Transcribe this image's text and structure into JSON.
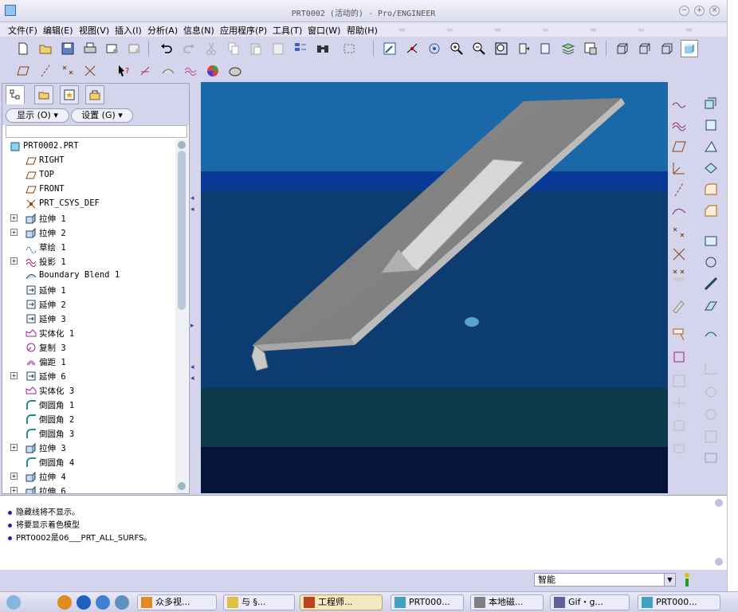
{
  "window": {
    "title": "PRT0002 (活动的) - Pro/ENGINEER"
  },
  "menu": [
    "文件(F)",
    "编辑(E)",
    "视图(V)",
    "插入(I)",
    "分析(A)",
    "信息(N)",
    "应用程序(P)",
    "工具(T)",
    "窗口(W)",
    "帮助(H)"
  ],
  "panel": {
    "show_label": "显示 (O) ▾",
    "settings_label": "设置 (G) ▾"
  },
  "tree": [
    {
      "label": "PRT0002.PRT",
      "icon": "part-icon",
      "expand": false,
      "indent": 0
    },
    {
      "label": "RIGHT",
      "icon": "datum-plane-icon",
      "expand": false,
      "indent": 1
    },
    {
      "label": "TOP",
      "icon": "datum-plane-icon",
      "expand": false,
      "indent": 1
    },
    {
      "label": "FRONT",
      "icon": "datum-plane-icon",
      "expand": false,
      "indent": 1
    },
    {
      "label": "PRT_CSYS_DEF",
      "icon": "csys-icon",
      "expand": false,
      "indent": 1
    },
    {
      "label": "拉伸 1",
      "icon": "extrude-icon",
      "expand": true,
      "indent": 1
    },
    {
      "label": "拉伸 2",
      "icon": "extrude-icon",
      "expand": true,
      "indent": 1
    },
    {
      "label": "草绘 1",
      "icon": "sketch-icon",
      "expand": false,
      "indent": 1
    },
    {
      "label": "投影 1",
      "icon": "projection-icon",
      "expand": true,
      "indent": 1
    },
    {
      "label": "Boundary Blend 1",
      "icon": "boundary-blend-icon",
      "expand": false,
      "indent": 1
    },
    {
      "label": "延伸 1",
      "icon": "extend-icon",
      "expand": false,
      "indent": 1
    },
    {
      "label": "延伸 2",
      "icon": "extend-icon",
      "expand": false,
      "indent": 1
    },
    {
      "label": "延伸 3",
      "icon": "extend-icon",
      "expand": false,
      "indent": 1
    },
    {
      "label": "实体化 1",
      "icon": "solidify-icon",
      "expand": false,
      "indent": 1
    },
    {
      "label": "复制 3",
      "icon": "copy-icon",
      "expand": false,
      "indent": 1
    },
    {
      "label": "偏距 1",
      "icon": "offset-icon",
      "expand": false,
      "indent": 1
    },
    {
      "label": "延伸 6",
      "icon": "extend-icon",
      "expand": true,
      "indent": 1
    },
    {
      "label": "实体化 3",
      "icon": "solidify-icon",
      "expand": false,
      "indent": 1
    },
    {
      "label": "倒圆角 1",
      "icon": "round-icon",
      "expand": false,
      "indent": 1
    },
    {
      "label": "倒圆角 2",
      "icon": "round-icon",
      "expand": false,
      "indent": 1
    },
    {
      "label": "倒圆角 3",
      "icon": "round-icon",
      "expand": false,
      "indent": 1
    },
    {
      "label": "拉伸 3",
      "icon": "extrude-icon",
      "expand": true,
      "indent": 1
    },
    {
      "label": "倒圆角 4",
      "icon": "round-icon",
      "expand": false,
      "indent": 1
    },
    {
      "label": "拉伸 4",
      "icon": "extrude-icon",
      "expand": true,
      "indent": 1
    },
    {
      "label": "拉伸 6",
      "icon": "extrude-icon",
      "expand": true,
      "indent": 1
    }
  ],
  "messages": [
    "隐藏线将不显示。",
    "将要显示着色模型",
    "PRT0002是06___PRT_ALL_SURFS。"
  ],
  "status": {
    "filter_value": "智能"
  },
  "taskbar": [
    {
      "label": "众多视...",
      "icon": "browser-icon",
      "active": false
    },
    {
      "label": "与 §...",
      "icon": "folder-icon",
      "active": false
    },
    {
      "label": "工程师...",
      "icon": "chat-icon",
      "active": true
    },
    {
      "label": "PRT000...",
      "icon": "proe-icon",
      "active": false
    },
    {
      "label": "本地磁...",
      "icon": "disk-icon",
      "active": false
    },
    {
      "label": "Gif・g...",
      "icon": "image-icon",
      "active": false
    },
    {
      "label": "PRT000...",
      "icon": "proe-icon",
      "active": false
    }
  ],
  "colors": {
    "viewport_top": "#20609c",
    "viewport_mid": "#0e3c6e",
    "model": "#9a9a9a",
    "model_light": "#c8c8c8",
    "ui_bg": "#d4d4ec"
  }
}
